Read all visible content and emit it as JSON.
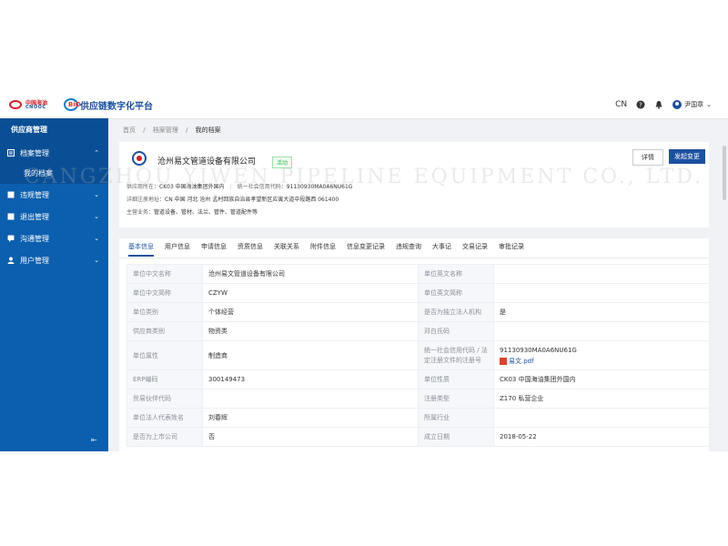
{
  "header": {
    "brand_cn": "中国海油",
    "brand_en": "CNOOC",
    "platform_title": "供应链数字化平台",
    "platform_mark": "BiO",
    "language": "CN",
    "user_name": "尹国章"
  },
  "sidebar": {
    "title": "供应商管理",
    "items": [
      {
        "label": "档案管理",
        "open": true
      },
      {
        "label": "违规管理"
      },
      {
        "label": "退出管理"
      },
      {
        "label": "沟通管理"
      },
      {
        "label": "用户管理"
      }
    ],
    "sub_item": "我的档案",
    "collapse_icon": "collapse-icon"
  },
  "breadcrumb": {
    "home": "首页",
    "section": "档案管理",
    "current": "我的档案",
    "separator": "/"
  },
  "company": {
    "name": "沧州易文管道设备有限公司",
    "status": "活动",
    "detail_button": "详情",
    "change_button": "发起变更",
    "supplier_attr_label": "供应商所在：",
    "supplier_attr_value": "CK03 中国海油集团外国内",
    "credit_code_label": "统一社会信用代码：",
    "credit_code_value": "91130930MA0A6NU61G",
    "address_label": "详细注册地址：",
    "address_value": "CN 中国 河北 沧州 孟村回族自治县孝望新区应寅大道中段路西 061400",
    "business_label": "主营业务：",
    "business_value": "管道设备、管材、法兰、管件、管道配件等"
  },
  "tabs": [
    "基本信息",
    "用户信息",
    "申请信息",
    "资质信息",
    "关联关系",
    "附件信息",
    "信息变更记录",
    "违规查询",
    "大事记",
    "交易记录",
    "审批记录"
  ],
  "table": {
    "rows": [
      {
        "k1": "单位中文名称",
        "v1": "沧州易文管道设备有限公司",
        "k2": "单位英文名称",
        "v2": ""
      },
      {
        "k1": "单位中文简称",
        "v1": "CZYW",
        "k2": "单位英文简称",
        "v2": ""
      },
      {
        "k1": "单位类别",
        "v1": "个体经营",
        "k2": "是否为独立法人机构",
        "v2": "是"
      },
      {
        "k1": "供应商类别",
        "v1": "物资类",
        "k2": "邓白氏码",
        "v2": ""
      },
      {
        "k1": "单位属性",
        "v1": "制造商",
        "k2": "统一社会信用代码 / 法定注册文件的注册号",
        "v2": "91130930MA0A6NU61G"
      },
      {
        "k1": "ERP编码",
        "v1": "300149473",
        "k2": "单位性质",
        "v2": "CK03 中国海油集团外国内"
      },
      {
        "k1": "贸易伙伴代码",
        "v1": "",
        "k2": "注册类型",
        "v2": "Z170 私营企业"
      },
      {
        "k1": "单位法人代表姓名",
        "v1": "刘春辉",
        "k2": "所属行业",
        "v2": ""
      },
      {
        "k1": "是否为上市公司",
        "v1": "否",
        "k2": "成立日期",
        "v2": "2018-05-22"
      }
    ],
    "attachment": "易文.pdf"
  },
  "watermark": "CANGZHOU YIWEN PIPELINE EQUIPMENT CO., LTD.",
  "colors": {
    "primary": "#1c50a0",
    "sidebar": "#0b5fae",
    "active_badge": "#36b84f"
  }
}
